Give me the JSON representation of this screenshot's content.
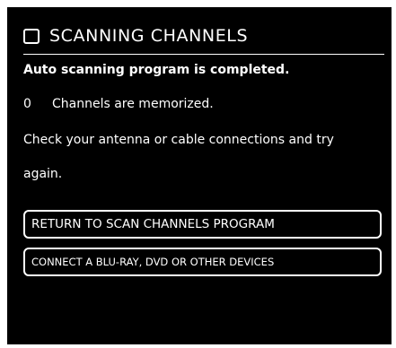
{
  "dialog": {
    "title": "SCANNING CHANNELS",
    "icon": "square-outline-icon",
    "status_message": "Auto scanning program is completed.",
    "channels_count": "0",
    "channels_text": "Channels are memorized.",
    "help_line_1": "Check your antenna or cable connections and try",
    "help_line_2": "again."
  },
  "buttons": {
    "return_label": "RETURN TO SCAN CHANNELS PROGRAM",
    "connect_label": "CONNECT A BLU-RAY, DVD OR OTHER DEVICES"
  },
  "colors": {
    "background": "#000000",
    "text": "#ffffff"
  }
}
